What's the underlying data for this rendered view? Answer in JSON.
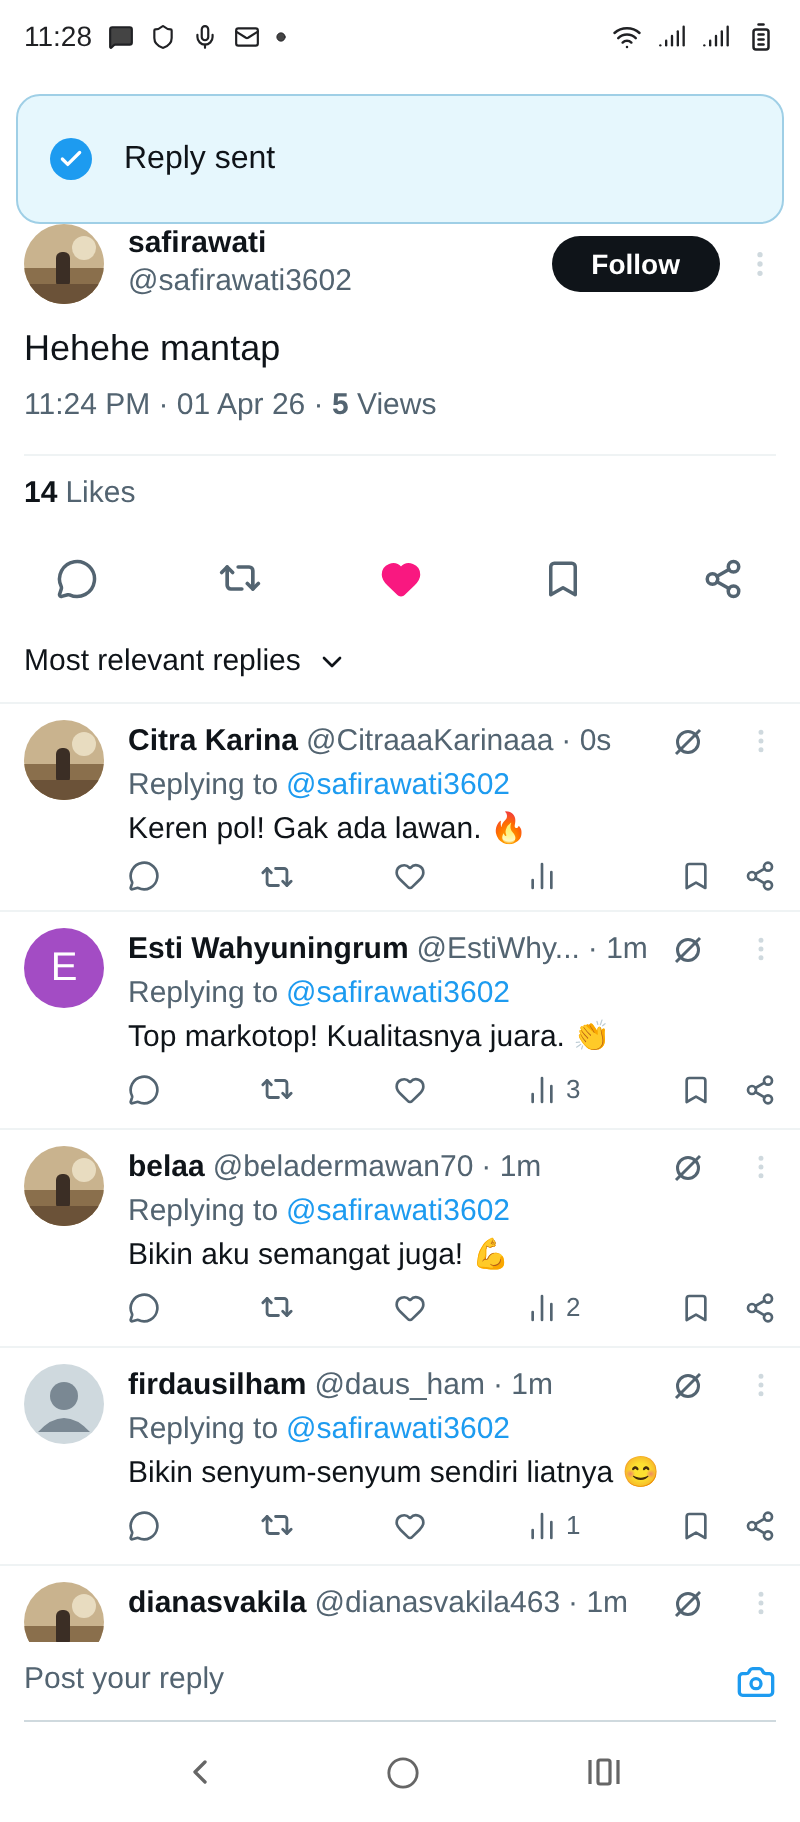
{
  "status_bar": {
    "time": "11:28"
  },
  "toast": {
    "message": "Reply sent"
  },
  "post": {
    "author": "safirawati",
    "handle": "@safirawati3602",
    "follow_label": "Follow",
    "text": "Hehehe mantap",
    "meta": "11:24 PM · 01 Apr 26 · **5** Views",
    "likes_count": "14",
    "likes_label": "Likes",
    "liked": true
  },
  "sort": {
    "label": "Most relevant replies"
  },
  "replies": [
    {
      "name": "Citra Karina",
      "handle": "@CitraaaKarinaaa",
      "time": "· 0s",
      "replying_prefix": "Replying to",
      "replying_handle": "@safirawati3602",
      "text": "Keren pol! Gak ada lawan. 🔥"
    },
    {
      "avatar": {
        "kind": "letter",
        "letter": "E",
        "color": "#a34cc4"
      },
      "name": "Esti Wahyuningrum",
      "handle": "@EstiWhy...",
      "time": "· 1m",
      "replying_prefix": "Replying to",
      "replying_handle": "@safirawati3602",
      "text": "Top markotop! Kualitasnya juara. 👏",
      "views": "3"
    },
    {
      "name": "belaa",
      "handle": "@beladermawan70",
      "time": "· 1m",
      "replying_prefix": "Replying to",
      "replying_handle": "@safirawati3602",
      "text": "Bikin aku semangat juga! 💪",
      "views": "2"
    },
    {
      "avatar": {
        "kind": "default"
      },
      "name": "firdausilham",
      "handle": "@daus_ham",
      "time": "· 1m",
      "replying_prefix": "Replying to",
      "replying_handle": "@safirawati3602",
      "text": "Bikin senyum-senyum sendiri liatnya 😊",
      "views": "1"
    },
    {
      "name": "dianasvakila",
      "handle": "@dianasvakila463",
      "time": "· 1m"
    }
  ],
  "reply_bar": {
    "placeholder": "Post your reply"
  }
}
